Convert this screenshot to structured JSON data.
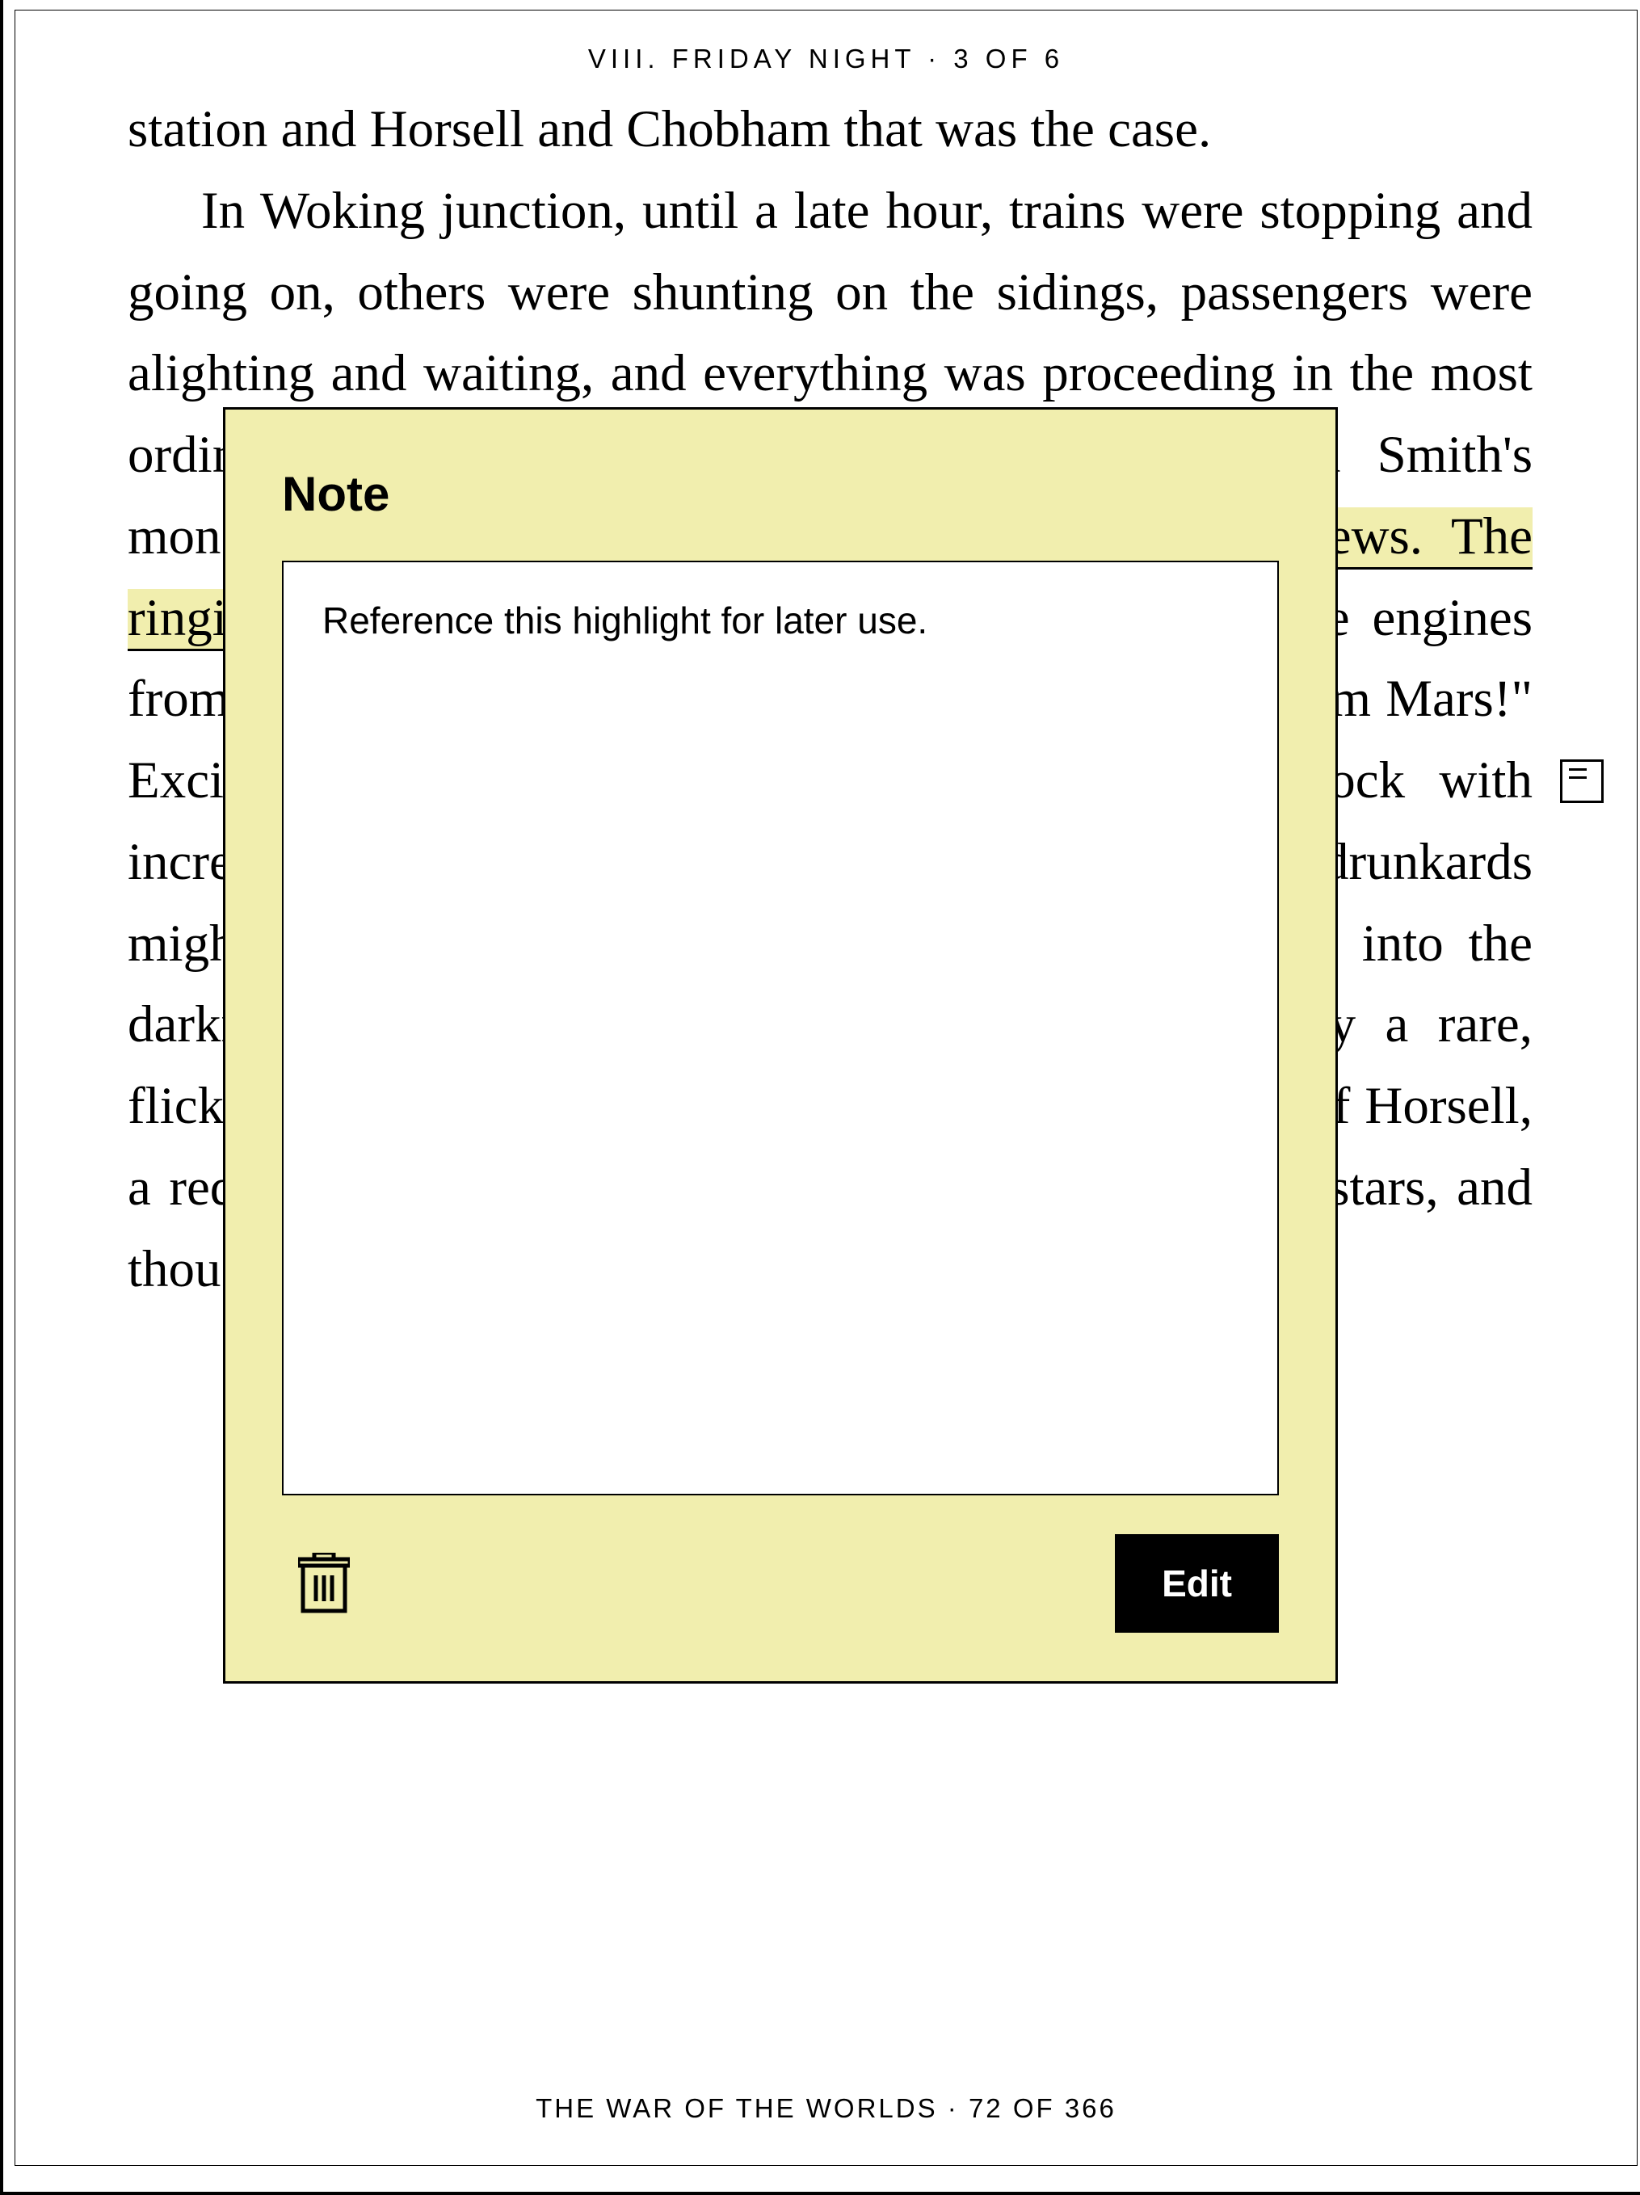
{
  "header": {
    "chapter_line": "VIII. FRIDAY NIGHT · 3 OF 6"
  },
  "body": {
    "para1_tail": "station and Horsell and Chobham that was the case.",
    "para2_pre": "In Woking junction, until a late hour, trains were stopping and going on, others were shunting on the sidings, passengers were alighting and waiting, and everything was proceeding in the most ordinary way. A boy from the town, trenching on Smith's monopoly, was selling papers with ",
    "para2_hl": "the afternoon's news. The ringing impact of trucks, the sym",
    "para2_post": " shrill whistles of the engines from the junction, mingled with their shouts of \"Men from Mars!\" Excited men came into the station about nine o'clock with incredible tidings, and caused no more disturbance than drunkards might have done. People rattling Londonwards peered into the darkness outside the carriage windows, and saw only a rare, flickering, vanishing spark dance up from the direction of Horsell, a red glow and a thin veil of smoke driving across the stars, and thought"
  },
  "note": {
    "title": "Note",
    "content": "Reference this highlight for later use.",
    "delete_label": "Delete",
    "edit_label": "Edit"
  },
  "footer": {
    "line": "THE WAR OF THE WORLDS · 72 OF 366"
  }
}
